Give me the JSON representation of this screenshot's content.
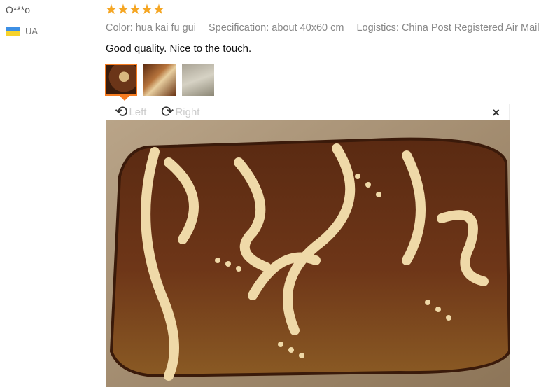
{
  "reviewer": {
    "name": "O***o",
    "country": "UA"
  },
  "rating": {
    "stars": 5,
    "max": 5
  },
  "attributes": {
    "color": "Color: hua kai fu gui",
    "specification": "Specification: about 40x60 cm",
    "logistics": "Logistics: China Post Registered Air Mail"
  },
  "review_text": "Good quality. Nice to the touch.",
  "thumbnails": 3,
  "viewer": {
    "rotate_left": "Left",
    "rotate_right": "Right",
    "close": "×"
  },
  "colors": {
    "star": "#f5a623",
    "active_border": "#f47b20"
  }
}
